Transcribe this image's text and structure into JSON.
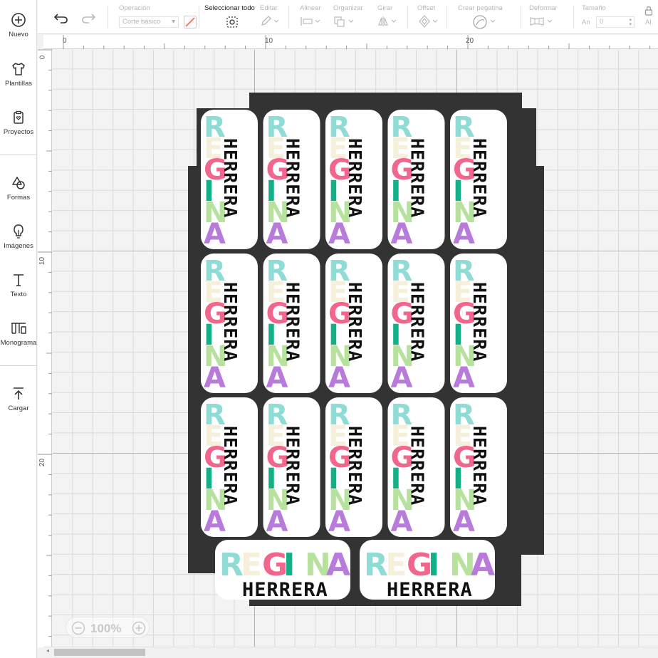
{
  "sidebar": {
    "items": [
      {
        "label": "Nuevo",
        "icon": "plus-circle-icon"
      },
      {
        "label": "Plantillas",
        "icon": "shirt-icon"
      },
      {
        "label": "Proyectos",
        "icon": "clipboard-heart-icon"
      },
      {
        "label": "Formas",
        "icon": "shapes-icon"
      },
      {
        "label": "Imágenes",
        "icon": "lightbulb-icon"
      },
      {
        "label": "Texto",
        "icon": "text-t-icon"
      },
      {
        "label": "Monograma",
        "icon": "monogram-icon"
      },
      {
        "label": "Cargar",
        "icon": "upload-icon"
      }
    ]
  },
  "toolbar": {
    "operation_label": "Operación",
    "operation_value": "Corte básico",
    "select_all_label": "Seleccionar todo",
    "edit_label": "Editar",
    "align_label": "Alinear",
    "arrange_label": "Organizar",
    "rotate_label": "Girar",
    "offset_label": "Offset",
    "sticker_label": "Crear pegatina",
    "warp_label": "Deformar",
    "size_label": "Tamaño",
    "width_label": "An",
    "width_value": "0",
    "height_label": "Al"
  },
  "ruler": {
    "top": [
      "0",
      "10",
      "20"
    ],
    "left": [
      "0",
      "10",
      "20"
    ]
  },
  "stickers": {
    "first_name": "REGINA",
    "last_name": "HERRERA",
    "letter_colors": [
      "#8fdcd6",
      "#f6efd9",
      "#f2658d",
      "#12b086",
      "#b7e29e",
      "#b87bdc"
    ],
    "last_name_color": "#111111",
    "mat_color": "#333333",
    "vertical_grid": {
      "columns": 5,
      "rows": 3
    },
    "horizontal_count": 2
  },
  "zoom": {
    "value": "100%"
  },
  "colors": {
    "accent": "#f08070"
  }
}
